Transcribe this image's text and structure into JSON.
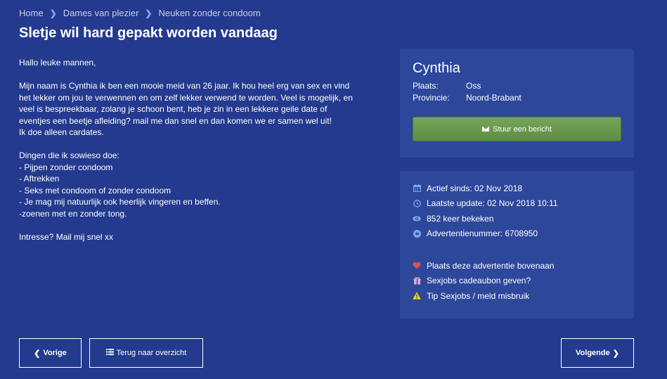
{
  "breadcrumb": [
    "Home",
    "Dames van plezier",
    "Neuken zonder condoom"
  ],
  "title": "Sletje wil hard gepakt worden vandaag",
  "body": {
    "greeting": "Hallo leuke mannen,",
    "intro": [
      "Mijn naam is Cynthia ik ben een mooie meid van 26 jaar. Ik hou heel erg van sex en vind",
      "het lekker om jou te verwennen en om zelf lekker verwend te worden. Veel is mogelijk, en",
      "veel is bespreekbaar, zolang je schoon bent, heb je zin in een lekkere geile date of",
      "eventjes een beetje afleiding? mail me dan snel en dan komen we er samen wel uit!",
      "Ik doe alleen cardates."
    ],
    "list": [
      "Dingen die ik sowieso doe:",
      "- Pijpen zonder condoom",
      "- Aftrekken",
      "- Seks met condoom of zonder condoom",
      "- Je mag mij natuurlijk ook heerlijk vingeren en beffen.",
      "-zoenen met en zonder tong."
    ],
    "closing": "Intresse? Mail mij snel xx"
  },
  "profile": {
    "name": "Cynthia",
    "plaats_label": "Plaats:",
    "plaats": "Oss",
    "provincie_label": "Provincie:",
    "provincie": "Noord-Brabant",
    "message_button": "Stuur een bericht"
  },
  "info": {
    "active_since": "Actief sinds: 02 Nov 2018",
    "last_update": "Laatste update: 02 Nov 2018 10:11",
    "views": "852 keer bekeken",
    "ad_number": "Advertentienummer: 6708950",
    "promote": "Plaats deze advertentie bovenaan",
    "voucher": "Sexjobs cadeaubon geven?",
    "report": "Tip Sexjobs / meld misbruik"
  },
  "nav": {
    "prev": "Vorige",
    "overview": "Terug naar overzicht",
    "next": "Volgende"
  },
  "colors": {
    "background": "#233a8e",
    "card": "#2d479b",
    "button_green": "#67994d",
    "icon_blue": "#7fa6e8",
    "heart_red": "#d9534f",
    "gift_pink": "#e0a8d8",
    "warning_yellow": "#f2d500"
  }
}
